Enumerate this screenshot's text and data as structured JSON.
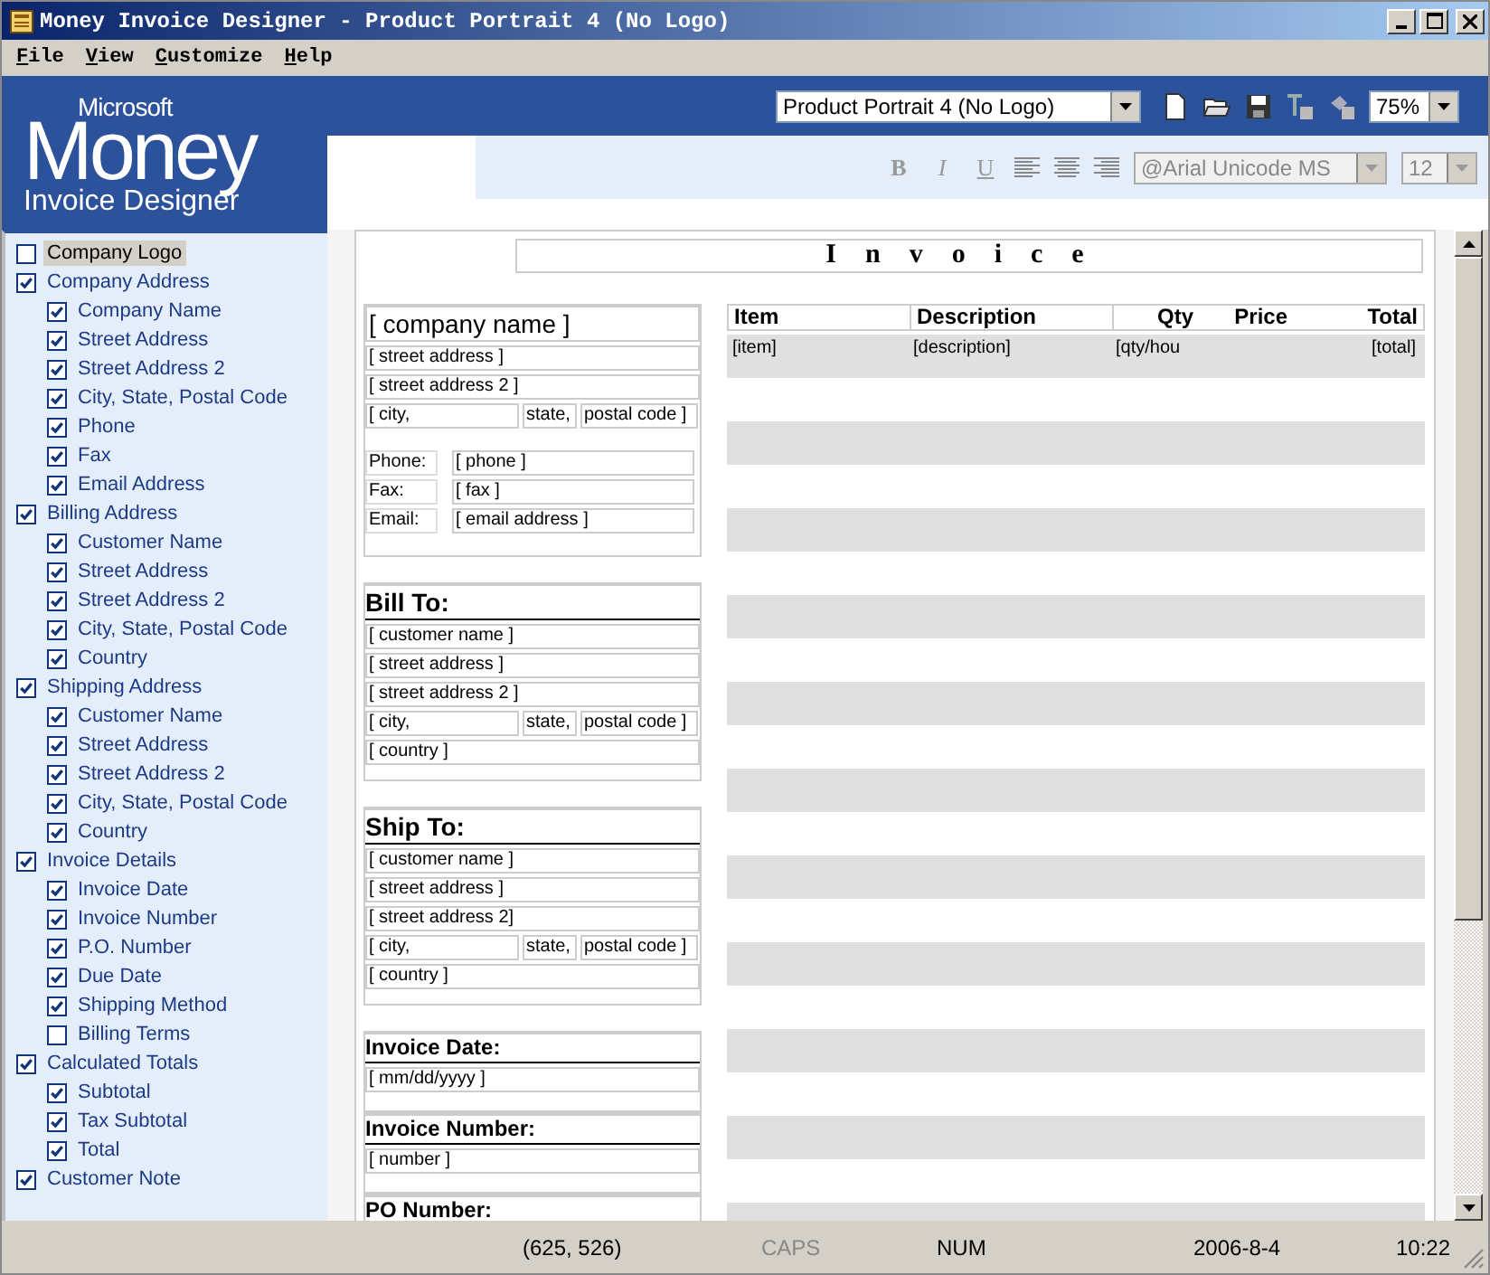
{
  "window": {
    "title": "Money Invoice Designer - Product Portrait 4 (No Logo)"
  },
  "menu": [
    "File",
    "View",
    "Customize",
    "Help"
  ],
  "logo": {
    "brand": "Microsoft",
    "product": "Money",
    "subtitle": "Invoice Designer"
  },
  "toolbar": {
    "template": "Product Portrait 4 (No Logo)",
    "zoom": "75%"
  },
  "format_bar": {
    "buttons": [
      {
        "label": "B",
        "kind": "bold",
        "disabled": true
      },
      {
        "label": "I",
        "kind": "italic",
        "disabled": true
      },
      {
        "label": "U",
        "kind": "underline",
        "disabled": true
      }
    ],
    "font": "@Arial Unicode MS",
    "size": "12",
    "disabled": true
  },
  "sidebar": {
    "items": [
      {
        "label": "Company Logo",
        "checked": false,
        "selected": true
      },
      {
        "label": "Company Address",
        "checked": true,
        "selected": false,
        "children": [
          {
            "label": "Company Name",
            "checked": true,
            "selected": false
          },
          {
            "label": "Street Address",
            "checked": true,
            "selected": false
          },
          {
            "label": "Street Address 2",
            "checked": true,
            "selected": false
          },
          {
            "label": "City, State, Postal Code",
            "checked": true,
            "selected": false
          },
          {
            "label": "Phone",
            "checked": true,
            "selected": false
          },
          {
            "label": "Fax",
            "checked": true,
            "selected": false
          },
          {
            "label": "Email Address",
            "checked": true,
            "selected": false
          }
        ]
      },
      {
        "label": "Billing Address",
        "checked": true,
        "selected": false,
        "children": [
          {
            "label": "Customer Name",
            "checked": true,
            "selected": false
          },
          {
            "label": "Street Address",
            "checked": true,
            "selected": false
          },
          {
            "label": "Street Address 2",
            "checked": true,
            "selected": false
          },
          {
            "label": "City, State, Postal Code",
            "checked": true,
            "selected": false
          },
          {
            "label": "Country",
            "checked": true,
            "selected": false
          }
        ]
      },
      {
        "label": "Shipping Address",
        "checked": true,
        "selected": false,
        "children": [
          {
            "label": "Customer Name",
            "checked": true,
            "selected": false
          },
          {
            "label": "Street Address",
            "checked": true,
            "selected": false
          },
          {
            "label": "Street Address 2",
            "checked": true,
            "selected": false
          },
          {
            "label": "City, State, Postal Code",
            "checked": true,
            "selected": false
          },
          {
            "label": "Country",
            "checked": true,
            "selected": false
          }
        ]
      },
      {
        "label": "Invoice Details",
        "checked": true,
        "selected": false,
        "children": [
          {
            "label": "Invoice Date",
            "checked": true,
            "selected": false
          },
          {
            "label": "Invoice Number",
            "checked": true,
            "selected": false
          },
          {
            "label": "P.O. Number",
            "checked": true,
            "selected": false
          },
          {
            "label": "Due Date",
            "checked": true,
            "selected": false
          },
          {
            "label": "Shipping Method",
            "checked": true,
            "selected": false
          },
          {
            "label": "Billing Terms",
            "checked": false,
            "selected": false
          }
        ]
      },
      {
        "label": "Calculated Totals",
        "checked": true,
        "selected": false,
        "children": [
          {
            "label": "Subtotal",
            "checked": true,
            "selected": false
          },
          {
            "label": "Tax Subtotal",
            "checked": true,
            "selected": false
          },
          {
            "label": "Total",
            "checked": true,
            "selected": false
          }
        ]
      },
      {
        "label": "Customer Note",
        "checked": true,
        "selected": false
      }
    ]
  },
  "invoice": {
    "title": "Invoice",
    "company": {
      "name": "[ company name ]",
      "street": "[ street address ]",
      "street2": "[ street address 2 ]",
      "city": "[ city,",
      "state": "state,",
      "postal": "postal code ]",
      "contacts": [
        {
          "label": "Phone:",
          "value": "[ phone ]"
        },
        {
          "label": "Fax:",
          "value": "[ fax ]"
        },
        {
          "label": "Email:",
          "value": "[ email address ]"
        }
      ]
    },
    "addresses": [
      {
        "heading": "Bill To:",
        "customer": "[ customer name ]",
        "street": "[ street address ]",
        "street2": "[ street address 2 ]",
        "city": "[ city,",
        "state": "state,",
        "postal": "postal code ]",
        "country": "[ country ]"
      },
      {
        "heading": "Ship To:",
        "customer": "[ customer name ]",
        "street": "[ street address ]",
        "street2": "[ street address 2]",
        "city": "[ city,",
        "state": "state,",
        "postal": "postal code ]",
        "country": "[ country ]"
      }
    ],
    "details": [
      {
        "heading": "Invoice Date:",
        "value": "[ mm/dd/yyyy ]"
      },
      {
        "heading": "Invoice Number:",
        "value": "[ number ]"
      },
      {
        "heading": "PO Number:"
      }
    ],
    "table": {
      "columns": [
        "Item",
        "Description",
        "Qty",
        "Price",
        "Total"
      ],
      "rows": [
        {
          "item": "[item]",
          "description": "[description]",
          "qty": "[qty/hou",
          "total": "[total]"
        }
      ]
    }
  },
  "status_bar": [
    {
      "text": "(625, 526)",
      "on": true
    },
    {
      "text": "CAPS",
      "on": false
    },
    {
      "text": "NUM",
      "on": true
    },
    {
      "text": "2006-8-4",
      "on": true
    },
    {
      "text": "10:22",
      "on": true
    }
  ]
}
